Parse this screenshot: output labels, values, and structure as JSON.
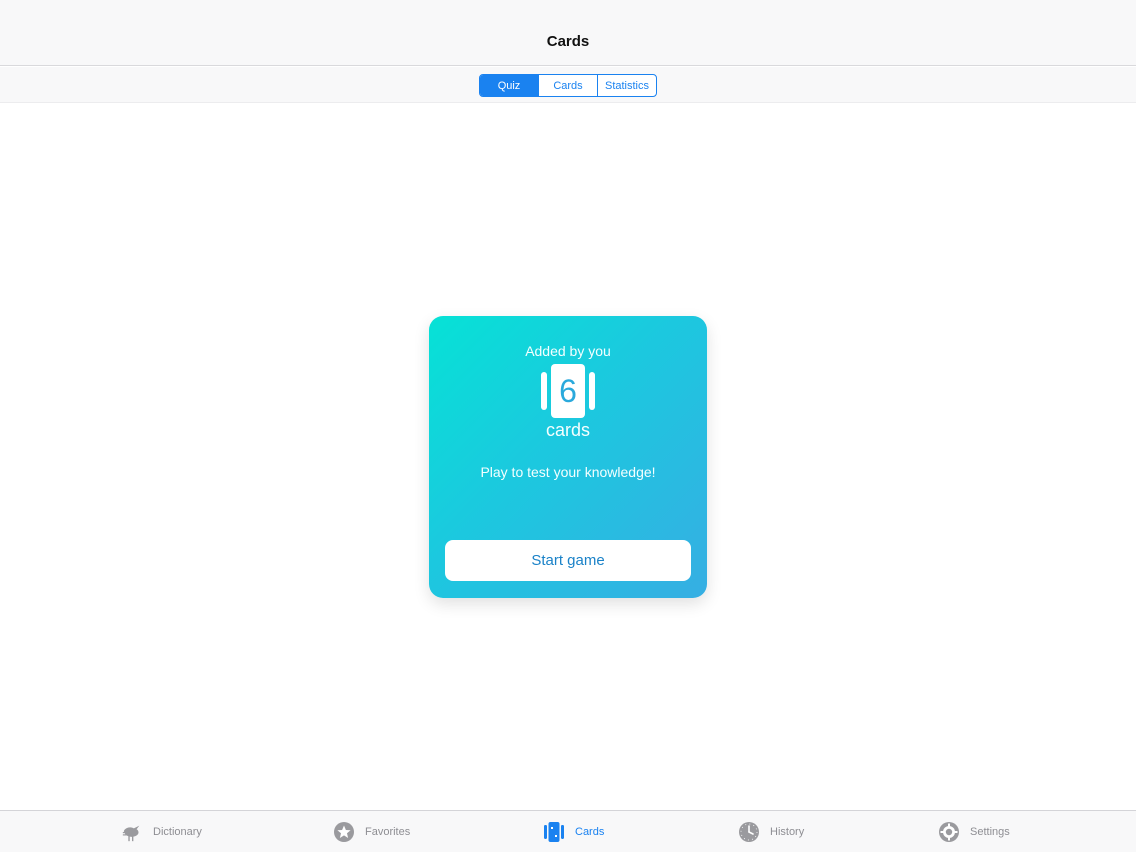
{
  "navbar": {
    "title": "Cards"
  },
  "segments": [
    {
      "label": "Quiz",
      "active": true
    },
    {
      "label": "Cards",
      "active": false
    },
    {
      "label": "Statistics",
      "active": false
    }
  ],
  "card": {
    "subtitle": "Added by you",
    "count": "6",
    "unit": "cards",
    "hint": "Play to test your knowledge!",
    "button": "Start game",
    "gradient": [
      "#06e2d6",
      "#36aee3"
    ]
  },
  "tabs": [
    {
      "label": "Dictionary",
      "icon": "bird-icon",
      "active": false
    },
    {
      "label": "Favorites",
      "icon": "star-icon",
      "active": false
    },
    {
      "label": "Cards",
      "icon": "cards-icon",
      "active": true
    },
    {
      "label": "History",
      "icon": "clock-icon",
      "active": false
    },
    {
      "label": "Settings",
      "icon": "gear-icon",
      "active": false
    }
  ],
  "colors": {
    "accent": "#1a82f0",
    "inactive": "#8e8e93"
  }
}
